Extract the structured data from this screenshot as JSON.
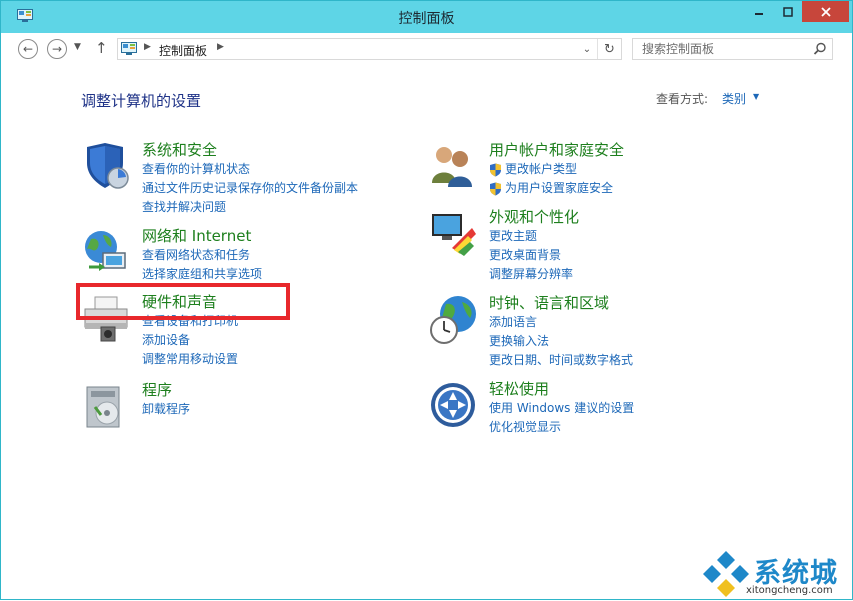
{
  "window": {
    "title": "控制面板"
  },
  "nav": {
    "breadcrumb": "控制面板",
    "search_placeholder": "搜索控制面板"
  },
  "header": {
    "page_title": "调整计算机的设置",
    "view_by_label": "查看方式:",
    "view_by_value": "类别"
  },
  "categories": [
    {
      "title": "系统和安全",
      "icon": "shield-icon",
      "links": [
        "查看你的计算机状态",
        "通过文件历史记录保存你的文件备份副本",
        "查找并解决问题"
      ]
    },
    {
      "title": "网络和 Internet",
      "icon": "network-globe-icon",
      "links": [
        "查看网络状态和任务",
        "选择家庭组和共享选项"
      ]
    },
    {
      "title": "硬件和声音",
      "icon": "printer-speaker-icon",
      "links": [
        "查看设备和打印机",
        "添加设备",
        "调整常用移动设置"
      ]
    },
    {
      "title": "程序",
      "icon": "programs-icon",
      "links": [
        "卸载程序"
      ]
    },
    {
      "title": "用户帐户和家庭安全",
      "icon": "users-icon",
      "links": [
        "更改帐户类型",
        "为用户设置家庭安全"
      ]
    },
    {
      "title": "外观和个性化",
      "icon": "monitor-palette-icon",
      "links": [
        "更改主题",
        "更改桌面背景",
        "调整屏幕分辨率"
      ]
    },
    {
      "title": "时钟、语言和区域",
      "icon": "clock-globe-icon",
      "links": [
        "添加语言",
        "更换输入法",
        "更改日期、时间或数字格式"
      ]
    },
    {
      "title": "轻松使用",
      "icon": "ease-of-access-icon",
      "links": [
        "使用 Windows 建议的设置",
        "优化视觉显示"
      ]
    }
  ],
  "watermark": {
    "text": "系统城",
    "url": "xitongcheng.com"
  },
  "colors": {
    "titlebar": "#5ed5e6",
    "category_title": "#1d7f1d",
    "link": "#1d68b8",
    "highlight": "#e8282c"
  }
}
